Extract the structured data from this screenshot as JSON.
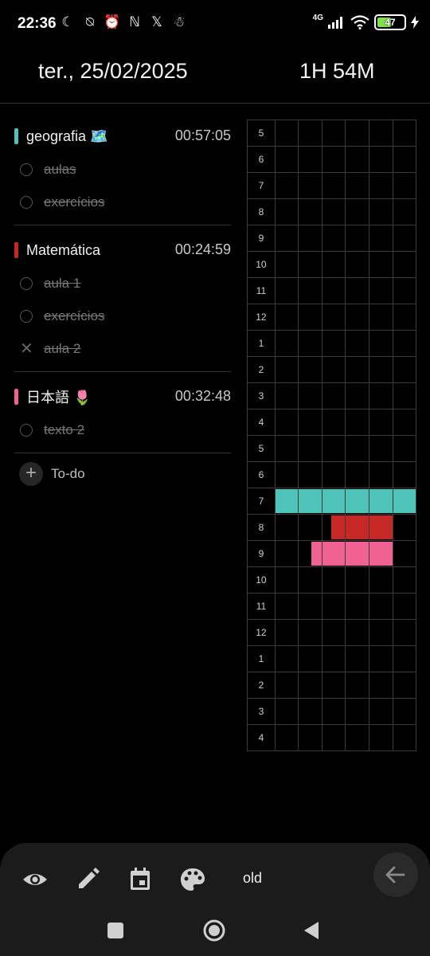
{
  "status": {
    "time": "22:36",
    "network": "4G",
    "battery": "47"
  },
  "header": {
    "date": "ter., 25/02/2025",
    "total": "1H 54M"
  },
  "subjects": [
    {
      "name": "geografia 🗺️",
      "time": "00:57:05",
      "color": "#4fc3b8",
      "tasks": [
        {
          "label": "aulas",
          "state": "done"
        },
        {
          "label": "exercícios",
          "state": "done"
        }
      ]
    },
    {
      "name": "Matemática",
      "time": "00:24:59",
      "color": "#c62828",
      "tasks": [
        {
          "label": "aula 1",
          "state": "done"
        },
        {
          "label": "exercícios",
          "state": "done"
        },
        {
          "label": "aula 2",
          "state": "cancelled"
        }
      ]
    },
    {
      "name": "日本語 🌷",
      "time": "00:32:48",
      "color": "#f06292",
      "tasks": [
        {
          "label": "texto 2",
          "state": "done"
        }
      ]
    }
  ],
  "todo": {
    "label": "To-do"
  },
  "timegrid": {
    "hours": [
      "5",
      "6",
      "7",
      "8",
      "9",
      "10",
      "11",
      "12",
      "1",
      "2",
      "3",
      "4",
      "5",
      "6",
      "7",
      "8",
      "9",
      "10",
      "11",
      "12",
      "1",
      "2",
      "3",
      "4"
    ],
    "blocks": [
      {
        "subject": 0,
        "row": 14,
        "start": 0.0,
        "end": 6.0
      },
      {
        "subject": 1,
        "row": 15,
        "start": 2.4,
        "end": 5.0
      },
      {
        "subject": 2,
        "row": 16,
        "start": 1.55,
        "end": 5.0
      }
    ]
  },
  "toolbar": {
    "icons": [
      "eye-icon",
      "pencil-icon",
      "calendar-icon",
      "palette-icon"
    ],
    "label": "old",
    "back": "arrow-left-icon"
  },
  "navbar": {
    "icons": [
      "recents-icon",
      "home-icon",
      "back-icon"
    ]
  }
}
